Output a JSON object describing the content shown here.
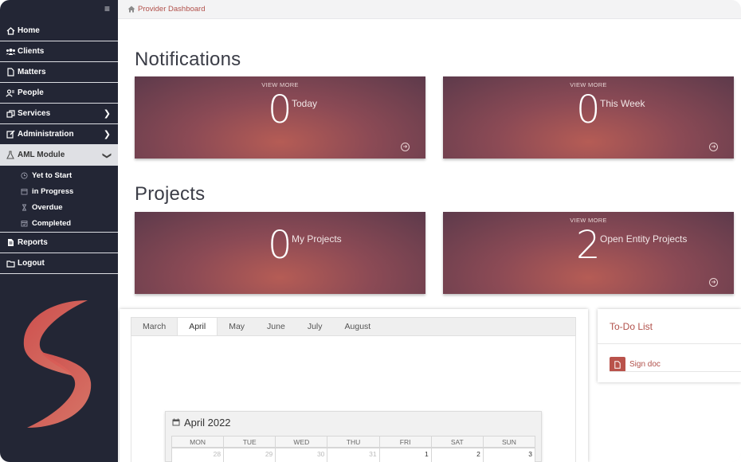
{
  "breadcrumb": {
    "label": "Provider Dashboard"
  },
  "sidebar": {
    "items": [
      {
        "label": "Home",
        "icon": "home-icon"
      },
      {
        "label": "Clients",
        "icon": "users-icon"
      },
      {
        "label": "Matters",
        "icon": "file-icon"
      },
      {
        "label": "People",
        "icon": "people-icon"
      },
      {
        "label": "Services",
        "icon": "services-icon"
      },
      {
        "label": "Administration",
        "icon": "edit-icon"
      },
      {
        "label": "AML Module",
        "icon": "flask-icon"
      },
      {
        "label": "Reports",
        "icon": "report-icon"
      },
      {
        "label": "Logout",
        "icon": "folder-icon"
      }
    ],
    "aml_sub": [
      {
        "label": "Yet to Start",
        "icon": "clock-icon"
      },
      {
        "label": "in Progress",
        "icon": "calendar-icon"
      },
      {
        "label": "Overdue",
        "icon": "hourglass-icon"
      },
      {
        "label": "Completed",
        "icon": "calendar-check-icon"
      }
    ]
  },
  "notifications": {
    "title": "Notifications",
    "cards": [
      {
        "view_more": "VIEW MORE",
        "count": "0",
        "label": "Today"
      },
      {
        "view_more": "VIEW MORE",
        "count": "0",
        "label": "This Week"
      }
    ]
  },
  "projects": {
    "title": "Projects",
    "cards": [
      {
        "view_more": "",
        "count": "0",
        "label": "My Projects"
      },
      {
        "view_more": "VIEW MORE",
        "count": "2",
        "label": "Open Entity Projects"
      }
    ]
  },
  "calendar": {
    "months": [
      "March",
      "April",
      "May",
      "June",
      "July",
      "August"
    ],
    "active_month": "April",
    "title": "April 2022",
    "weekdays": [
      "MON",
      "TUE",
      "WED",
      "THU",
      "FRI",
      "SAT",
      "SUN"
    ],
    "first_row": [
      "28",
      "29",
      "30",
      "31",
      "1",
      "2",
      "3"
    ]
  },
  "todo": {
    "title": "To-Do List",
    "items": [
      {
        "label": "Sign doc"
      }
    ]
  },
  "colors": {
    "accent": "#b1504a",
    "sidebar_bg": "#232635",
    "card_center": "#b55c55",
    "card_edge": "#5d3a4b"
  }
}
